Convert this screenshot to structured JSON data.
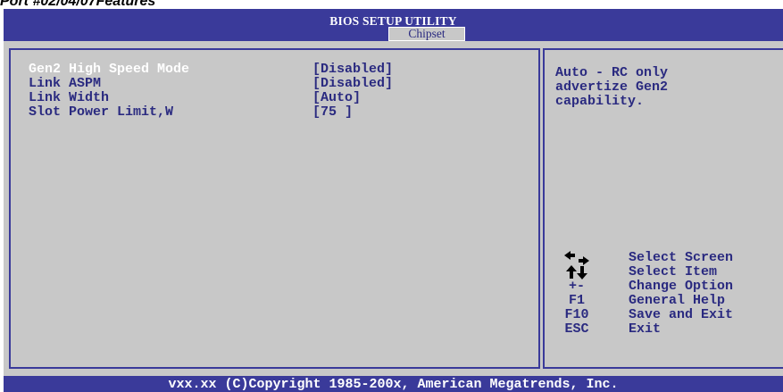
{
  "page_heading": "Port #02/04/07Features",
  "header": {
    "title": "BIOS SETUP UTILITY",
    "active_tab": "Chipset"
  },
  "settings": [
    {
      "label": "Gen2 High Speed Mode",
      "value": "[Disabled]",
      "selected": true
    },
    {
      "label": "Link ASPM",
      "value": "[Disabled]",
      "selected": false
    },
    {
      "label": "Link Width",
      "value": "[Auto]",
      "selected": false
    },
    {
      "label": "Slot Power Limit,W",
      "value": "[75 ]",
      "selected": false
    }
  ],
  "help": {
    "text": "Auto - RC only\nadvertize Gen2\ncapability."
  },
  "legend": [
    {
      "icon": "left-right-arrows-icon",
      "key": "",
      "desc": "Select Screen"
    },
    {
      "icon": "up-down-arrows-icon",
      "key": "",
      "desc": "Select Item"
    },
    {
      "icon": "",
      "key": "+-",
      "desc": "Change Option"
    },
    {
      "icon": "",
      "key": "F1",
      "desc": "General Help"
    },
    {
      "icon": "",
      "key": "F10",
      "desc": "Save and Exit"
    },
    {
      "icon": "",
      "key": "ESC",
      "desc": "Exit"
    }
  ],
  "footer": {
    "text": "vxx.xx (C)Copyright 1985-200x, American Megatrends, Inc."
  },
  "colors": {
    "frame_blue": "#3a3a9a",
    "panel_gray": "#c8c8c8",
    "text_blue": "#2a2a80",
    "highlight_white": "#ffffff"
  }
}
